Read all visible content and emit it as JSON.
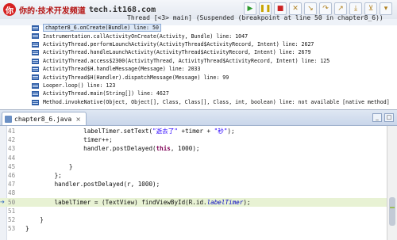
{
  "watermark": {
    "logo": "你",
    "title": "你的·技术开发频道",
    "site": "tech.it168.com"
  },
  "debug": {
    "thread_label": "Thread [<3> main] (Suspended (breakpoint at line 50 in chapter8_6))",
    "stack_frames": [
      "chapter8_6.onCreate(Bundle) line: 50",
      "Instrumentation.callActivityOnCreate(Activity, Bundle) line: 1047",
      "ActivityThread.performLaunchActivity(ActivityThread$ActivityRecord, Intent) line: 2627",
      "ActivityThread.handleLaunchActivity(ActivityThread$ActivityRecord, Intent) line: 2679",
      "ActivityThread.access$2300(ActivityThread, ActivityThread$ActivityRecord, Intent) line: 125",
      "ActivityThread$H.handleMessage(Message) line: 2033",
      "ActivityThread$H(Handler).dispatchMessage(Message) line: 99",
      "Looper.loop() line: 123",
      "ActivityThread.main(String[]) line: 4627",
      "Method.invokeNative(Object, Object[], Class, Class[], Class, int, boolean) line: not available [native method]"
    ],
    "toolbar_icons": [
      "resume-icon",
      "suspend-icon",
      "terminate-icon",
      "disconnect-icon",
      "step-into-icon",
      "step-over-icon",
      "step-return-icon",
      "drop-to-frame-icon",
      "use-step-filters-icon",
      "view-menu-icon"
    ]
  },
  "editor": {
    "tab_label": "chapter8_6.java",
    "tab_close": "×",
    "window_buttons": [
      "_",
      "□"
    ],
    "lines": [
      {
        "n": "41",
        "parts": [
          [
            "",
            "                labelTimer.setText("
          ],
          [
            "str",
            "\"逝去了\""
          ],
          [
            "",
            " +timer + "
          ],
          [
            "str",
            "\"秒\""
          ],
          [
            "",
            ");"
          ]
        ]
      },
      {
        "n": "42",
        "parts": [
          [
            "",
            "                timer++;"
          ]
        ]
      },
      {
        "n": "43",
        "parts": [
          [
            "",
            "                handler.postDelayed("
          ],
          [
            "kw",
            "this"
          ],
          [
            "",
            ", 1000);"
          ]
        ]
      },
      {
        "n": "44",
        "parts": [
          [
            "",
            ""
          ]
        ]
      },
      {
        "n": "45",
        "parts": [
          [
            "",
            "            }"
          ]
        ]
      },
      {
        "n": "46",
        "parts": [
          [
            "",
            "        };"
          ]
        ]
      },
      {
        "n": "47",
        "parts": [
          [
            "",
            "        handler.postDelayed(r, 1000);"
          ]
        ]
      },
      {
        "n": "48",
        "parts": [
          [
            "",
            ""
          ]
        ]
      },
      {
        "n": "50",
        "parts": [
          [
            "",
            "        labelTimer = (TextView) findViewById(R.id."
          ],
          [
            "fld",
            "labelTimer"
          ],
          [
            "",
            ");"
          ]
        ],
        "current": true
      },
      {
        "n": "51",
        "parts": [
          [
            "",
            ""
          ]
        ]
      },
      {
        "n": "52",
        "parts": [
          [
            "",
            "    }"
          ]
        ]
      },
      {
        "n": "53",
        "parts": [
          [
            "",
            "}"
          ]
        ]
      }
    ]
  },
  "colors": {
    "current_line": "#e8f2d4",
    "keyword": "#7f0055",
    "string": "#2a00ff",
    "selection": "#dde8f6"
  }
}
